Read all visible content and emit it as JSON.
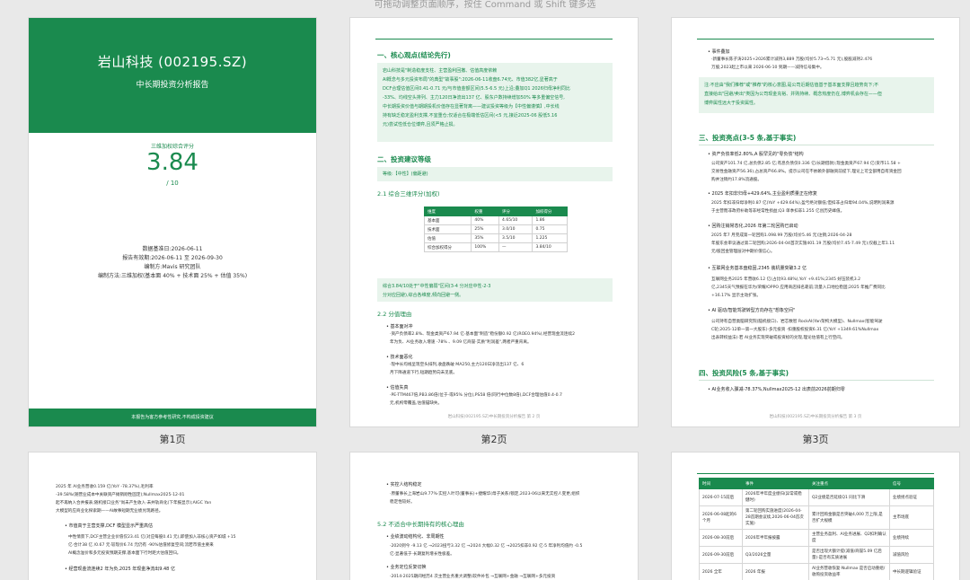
{
  "hint": "可拖动调整页面顺序，按住 Command 或 Shift 键多选",
  "pages": {
    "p1_label": "第1页",
    "p2_label": "第2页",
    "p3_label": "第3页"
  },
  "cover": {
    "title": "岩山科技 (002195.SZ)",
    "subtitle": "中长期投资分析报告",
    "score_label": "三维加权综合评分",
    "score": "3.84",
    "score_max": "/ 10",
    "meta": [
      "数据基准日:2026-06-11",
      "报告有效期:2026-06-11 至 2026-09-30",
      "编制方:Mavis 研究团队",
      "编制方法:三维加权(基本面 40% + 技术面 25% + 估值 35%)"
    ],
    "footer": "本报告为客方参考性研究,不构成投资建议"
  },
  "p2": {
    "s1_title": "一、核心观点(结论先行)",
    "s1_box": [
      "岩山科技是\"制造稳度支柱、主营盈利回撤、估值高度依赖",
      "AI概念与多元投资布局\"的典型\"故事股\":2026-06-11收盘6.74元、市值382亿,显著高于",
      "DCF合理估值区间0.41-0.71 元/与市值金额区间(5.5-6.5 元)上沿;叠加Q1 2026归母净利同比",
      "-33%、均线空头排列、主力120日净流出137 亿、股东户数持续增加50% 等多重偏空信号,",
      "中长期投资价值与期期投机价值存在显著背离——建议投资等级为【中性偏谨慎】,中长线",
      "持有缺乏稳定盈利支撑,不宜重仓;仅适合在极端低估区间(<5 元,接近2025-06 股低5.16",
      "元)尝试性低仓位博弈,且须严格止损。"
    ],
    "s2_title": "二、投资建议等级",
    "s2_box": "等级:【中性】(偏距避)",
    "s21_title": "2.1 综合三维评分(加权)",
    "table": {
      "headers": [
        "维度",
        "权重",
        "评分",
        "加权得分"
      ],
      "rows": [
        [
          "基本面",
          "40%",
          "4.65/10",
          "1.86"
        ],
        [
          "技术面",
          "25%",
          "3.0/10",
          "0.75"
        ],
        [
          "估值",
          "35%",
          "3.5/10",
          "1.225"
        ],
        [
          "综合加权得分",
          "100%",
          "—",
          "3.84/10"
        ]
      ]
    },
    "s21_box": [
      "综合3.84/10处于\"中性偏弱\"区间(3-4 分对应中性-2-3",
      "分对应回避),综合各维度,倾向回避一侧。"
    ],
    "s22_title": "2.2 分值理由",
    "b1": "基本面对冲",
    "t1": [
      "·资产负债率2.8%、现金类资产67.94 亿·基本面\"制造\"稳份额0.92 亿(ROE0.94%),经营现金流连续2",
      "年为负、AI业务收入增速 -78% 、9.09 亿商誉·实质\"利润差\",两者严重背离。"
    ],
    "b2": "技术面恶化",
    "t2": [
      "·现中长均线呈现空头排列,收盘跌破 MA250,主力120日净流出137 亿、6",
      "月下降通道下行,短期趋势向未见底。"
    ],
    "b3": "估值失真",
    "t3": [
      "·PE-TTM467倍,PB3.86倍(位于-或95% 分位),PS58 倍(同行中位数8倍),DCF合理估值0.4-0.7",
      "元,机构零覆盖,估值锚缺失。"
    ],
    "footer": "岩山科技(002195.SZ)中长期投资分析报告       第 2 页"
  },
  "p3": {
    "b0": "事件叠加",
    "t0": [
      "·新董事长陈子涛2025+2026累计减持3,889 万股(均价5.73→5.71 元),股股减持2.476",
      "万股,2023起上市以来 2026-06-10 到期——减持信号集中。"
    ],
    "note": [
      "注:不应由\"我们推荐\"或\"推荐\"的核心意图,是公司近期估值基于基本面支撑且趋势向下;不",
      "直接给出\"回避/卖出\"类因为公司现金充裕、并购持续、概念热度仍在,博弈机会存在——但",
      "博弈属性远大于投资属性。"
    ],
    "s3_title": "三、投资亮点(3-5 条,基于事实)",
    "i1": "资产负债率低2.80%,A 股罕见的\"零负债\"结构",
    "i1t": [
      "公司资产101.74 亿,总负债2.85 亿;有息负债仅0.336 亿(长期借款);现金类资产67.94 亿(货币11.58 +",
      "交易性金融资产56.36),占总资产66.8%。提示公司在不依赖外部融资前提下,理论上可全部用自有资金回",
      "购并注销约17.8%流通股。"
    ],
    "i2": "2025 年扣非归母+429.64%,主业盈利质量正在修复",
    "i2t": [
      "2025 年扣非归母净利0.87 亿(YoY +429.64%),盈亏绝对额低;但扣非占归母94.04%,说明利润来源",
      "于主营而非政府补助等非经常性损益;Q3 单季扣非1.255 亿创历史峰值。"
    ],
    "i3": "回购注销常态化,2026 年第二轮回购已启动",
    "i3t": [
      "2025    年7    月完成第一轮回购1.098.99    万股(均价5.46    元)注销;2026-04-28",
      "年股东会审议通过第二轮回购;2026-04-04首次实施401.19    万股(均价7.45-7.49    元);仅截上年1.11",
      "元/股回金管理层对中期价值信心。"
    ],
    "i4": "互联网业务基本盘稳固,2345 装机量突破3.2 亿",
    "i4t": [
      "互联网业务2025    年营收6.12    亿(占比93.48%),YoY    +9.41%;2345    好压装机3.2",
      "亿,2345天气预报在华为/荣耀/OPPO    应用商店排名靠前;流量入口地位稳固;2025    年推广费同比",
      "+16.17% 显示主动扩张。"
    ],
    "i5": "AI 驱动/智能驾驶转型方向存在\"想象空间\"",
    "i5t": [
      "公司持有自营类脑研究院(脑机接口)、岩芯数智    RockAI(Yan架构大模型)、Nullmax(智能驾驶",
      "C轮;2025-12单一第一大股东)·多元投资    ·扣重股权投资6.31    亿(YoY    +1349.61%Nullmax",
      "出表转权益法)·若 AI业务实现突破或投资标的兑现,理论估值有上行空间。"
    ],
    "s4_title": "四、投资风险(5 条,基于事实)",
    "r1": "AI业务收入骤减-78.37%,Nullmax2025-12 出表前2026前期归零",
    "footer": "岩山科技(002195.SZ)中长期投资分析报告       第 3 页"
  },
  "p4": {
    "lines": [
      "2025        年        AI业务营收0.159        亿(YoY        -78.37%),毛利率",
      "-39.58%(随营业成本中关联资产摊销刚性固定);Nullmax2025-12-01",
      "起不再纳入合并报表;随机接口业务\"尚未产生收入·未并轨商化(下年报显示);AIGC        Yan",
      "大模型的应商业化探索期——AI故事短期无业绩兑现路径。"
    ],
    "b1": "市值高于主营支撑,DCF 模型显示严重高估",
    "b1t": [
      "中性情景下,DCF主营企业价值仅23.41    亿(对应每股0.41    元),即使加入非核心资产如城    +15",
      "亿·合计38    亿    /0.67    元·较现价6.74    元仍有    -90%估值修复空间;流若市值主要来",
      "AI概念溢价和多元投资预期支撑,基本面下行时距大估值回归。"
    ],
    "b2": "经营现金流连续2 年为负,2025 年现金净流出9.48 亿"
  },
  "p5": {
    "b1": "实控人结构稳定",
    "b1t": [
      "·原董事长上海岩山9.77%·实控人叶可(董事长)+捷耀华(母子关系)锁定,2023-06以来无实控人变更,组织",
      "稳定性较好。"
    ],
    "s52_title": "5.2 不适合中长期持有的核心理由",
    "b2": "业绩波动结构化、非周期性",
    "b2t": [
      "·2020到今 -9.13 亿 →2023扭亏3.32 亿 →2024 大幅0.32 亿 →2025扣非0.92 亿·5 年净利均值约 -0.5",
      "亿·显著低于·长期复利增长性极差。"
    ],
    "b3": "业务定位反复切换",
    "b3t": [
      "·2014-2025期间经历4 次主营业务重大调整(软件补包 →互联网+金融 →互联网+多元投资"
    ]
  },
  "p6": {
    "headers": [
      "时间",
      "事件",
      "关注重点",
      "信号"
    ],
    "rows": [
      [
        "2026-07-15前后",
        "2026年半年度业绩归(异常或稳健时)",
        "Q2业绩是否延续Q1 同比下滑",
        "业绩拐点验证"
      ],
      [
        "2026-06-08起的6 个月",
        "第二轮回购实施进度(2026-04-28首期会议续,2026-06-04首次实施)",
        "累计回购金额是否突破4,000 万上限,是否扩大规模",
        "主市场底"
      ],
      [
        "2026-08-30前后",
        "2026年半年报披露",
        "主营业务盈利、AI业务进展、Q2扣利确认度",
        "业绩持续"
      ],
      [
        "2026-09-30前后",
        "Q3/2026全量",
        "是否出现大额计提(减值/商誉5.09 亿后量)·是否有实质进展",
        "减值风险"
      ],
      [
        "2026 全年",
        "2026 年报",
        "AI业务营收恢复·Nullmax 是否启动重组/收购投资收益率",
        "中长期逻辑验证"
      ]
    ]
  }
}
